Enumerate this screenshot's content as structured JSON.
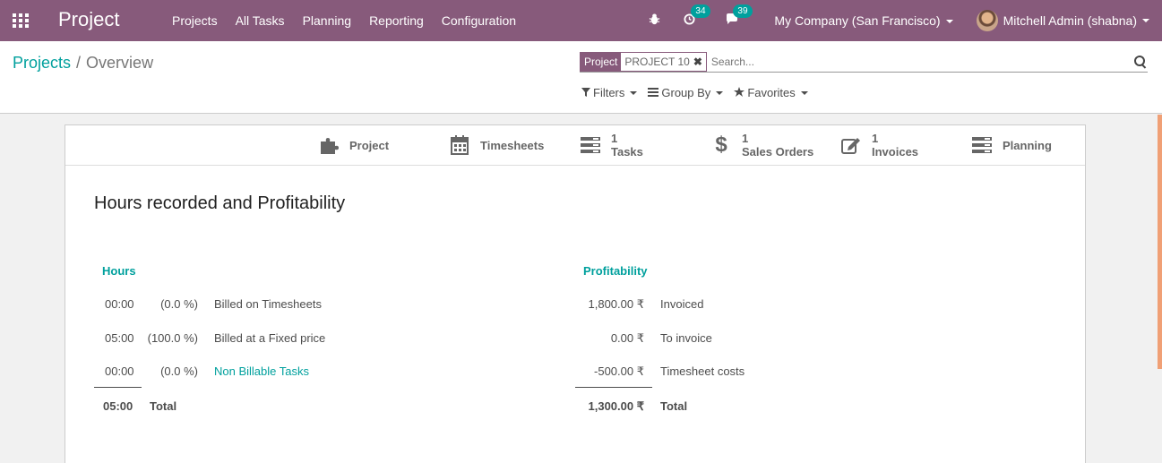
{
  "navbar": {
    "brand": "Project",
    "menu": [
      "Projects",
      "All Tasks",
      "Planning",
      "Reporting",
      "Configuration"
    ],
    "activity_count": "34",
    "messages_count": "39",
    "company": "My Company (San Francisco)",
    "user": "Mitchell Admin (shabna)"
  },
  "breadcrumb": {
    "parent": "Projects",
    "separator": "/",
    "current": "Overview"
  },
  "search": {
    "facet_category": "Project",
    "facet_value": "PROJECT 10",
    "placeholder": "Search..."
  },
  "filters": {
    "filters_label": "Filters",
    "groupby_label": "Group By",
    "favorites_label": "Favorites"
  },
  "stat_buttons": [
    {
      "icon": "puzzle-icon",
      "count": "",
      "label": "Project"
    },
    {
      "icon": "calendar-icon",
      "count": "",
      "label": "Timesheets"
    },
    {
      "icon": "tasks-icon",
      "count": "1",
      "label": "Tasks"
    },
    {
      "icon": "dollar-icon",
      "count": "1",
      "label": "Sales Orders"
    },
    {
      "icon": "edit-icon",
      "count": "1",
      "label": "Invoices"
    },
    {
      "icon": "tasks-icon",
      "count": "",
      "label": "Planning"
    }
  ],
  "overview": {
    "title": "Hours recorded and Profitability",
    "hours": {
      "header": "Hours",
      "rows": [
        {
          "value": "00:00",
          "percent": "(0.0 %)",
          "label": "Billed on Timesheets"
        },
        {
          "value": "05:00",
          "percent": "(100.0 %)",
          "label": "Billed at a Fixed price"
        },
        {
          "value": "00:00",
          "percent": "(0.0 %)",
          "label": "Non Billable Tasks"
        }
      ],
      "total_value": "05:00",
      "total_label": "Total"
    },
    "profitability": {
      "header": "Profitability",
      "rows": [
        {
          "value": "1,800.00 ₹",
          "label": "Invoiced"
        },
        {
          "value": "0.00 ₹",
          "label": "To invoice"
        },
        {
          "value": "-500.00 ₹",
          "label": "Timesheet costs"
        }
      ],
      "total_value": "1,300.00 ₹",
      "total_label": "Total"
    }
  },
  "colors": {
    "primary": "#875a7b",
    "accent": "#00a09d"
  }
}
